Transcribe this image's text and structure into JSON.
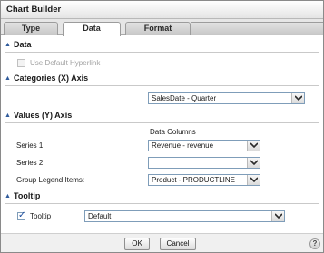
{
  "window": {
    "title": "Chart Builder"
  },
  "tabs": {
    "type": "Type",
    "data": "Data",
    "format": "Format",
    "active": "Data"
  },
  "data_section": {
    "header": "Data",
    "use_default_hyperlink_label": "Use Default Hyperlink",
    "use_default_hyperlink_checked": false,
    "use_default_hyperlink_enabled": false
  },
  "categories_section": {
    "header": "Categories (X) Axis",
    "axis_value": "SalesDate - Quarter"
  },
  "values_section": {
    "header": "Values (Y) Axis",
    "data_columns_label": "Data Columns",
    "series1_label": "Series 1:",
    "series1_value": "Revenue - revenue",
    "series2_label": "Series 2:",
    "series2_value": "",
    "group_legend_label": "Group Legend Items:",
    "group_legend_value": "Product - PRODUCTLINE"
  },
  "tooltip_section": {
    "header": "Tooltip",
    "tooltip_label": "Tooltip",
    "tooltip_checked": true,
    "tooltip_value": "Default"
  },
  "footer": {
    "ok": "OK",
    "cancel": "Cancel",
    "help": "?"
  }
}
